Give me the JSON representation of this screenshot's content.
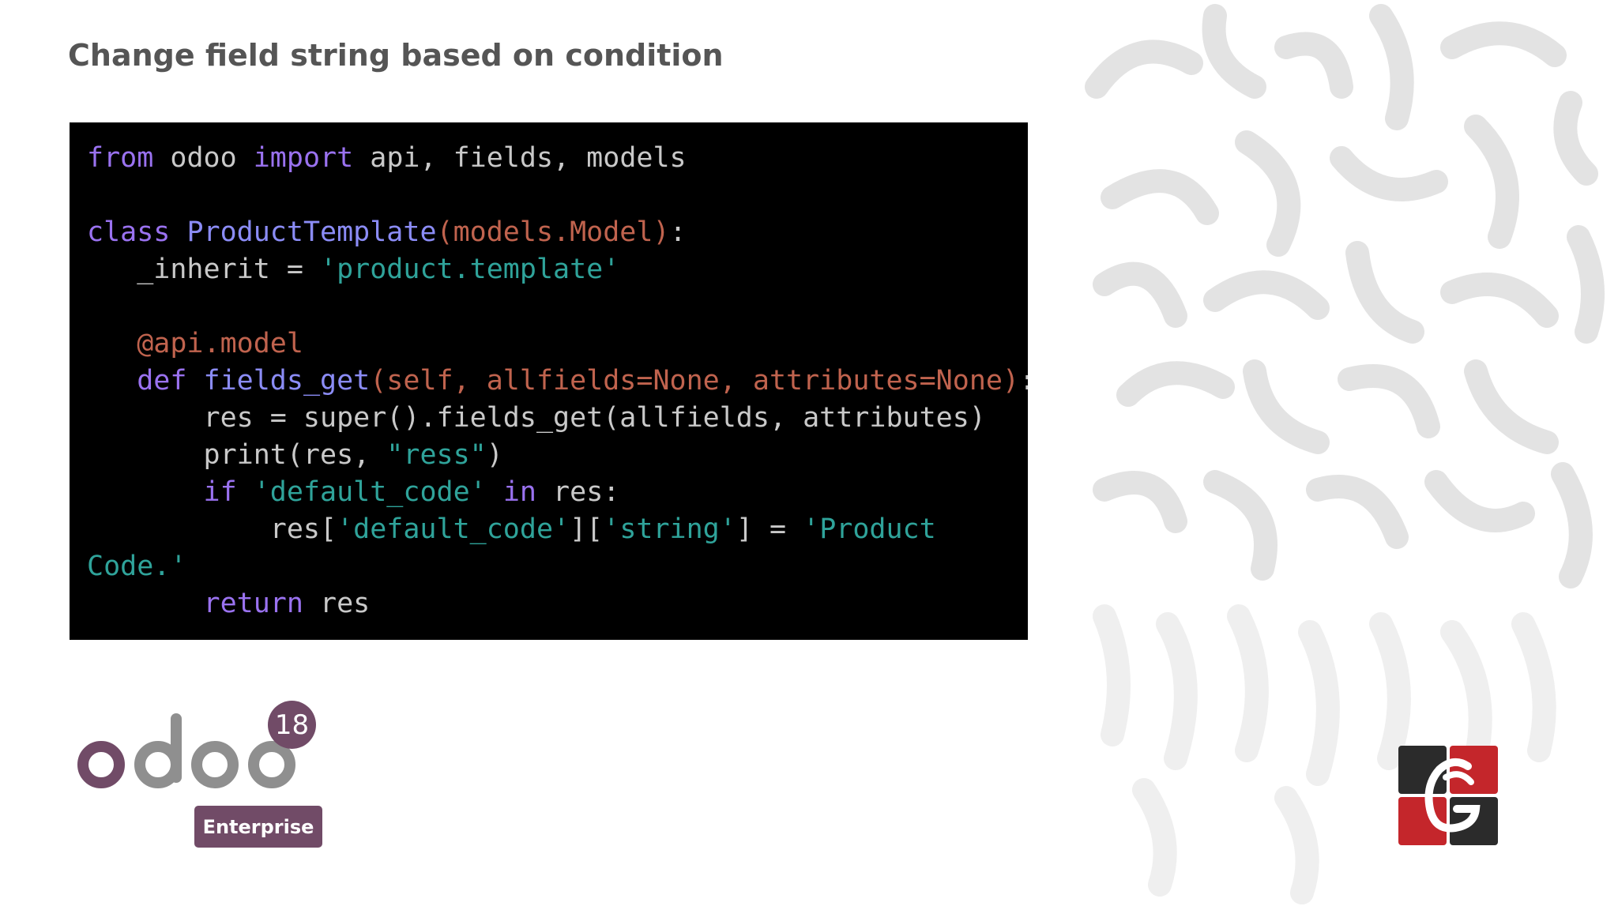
{
  "slide": {
    "title": "Change field string based on condition"
  },
  "code": {
    "lines": [
      [
        {
          "t": "kw",
          "v": "from"
        },
        {
          "t": "plain",
          "v": " odoo "
        },
        {
          "t": "kw",
          "v": "import"
        },
        {
          "t": "plain",
          "v": " api, fields, models"
        }
      ],
      [],
      [
        {
          "t": "kw",
          "v": "class"
        },
        {
          "t": "plain",
          "v": " "
        },
        {
          "t": "cls",
          "v": "ProductTemplate"
        },
        {
          "t": "param",
          "v": "(models.Model)"
        },
        {
          "t": "plain",
          "v": ":"
        }
      ],
      [
        {
          "t": "plain",
          "v": "   _inherit = "
        },
        {
          "t": "str",
          "v": "'product.template'"
        }
      ],
      [],
      [
        {
          "t": "dec",
          "v": "   @api.model"
        }
      ],
      [
        {
          "t": "kw",
          "v": "   def"
        },
        {
          "t": "plain",
          "v": " "
        },
        {
          "t": "fn",
          "v": "fields_get"
        },
        {
          "t": "param",
          "v": "(self, allfields=None, attributes=None)"
        },
        {
          "t": "plain",
          "v": ":"
        }
      ],
      [
        {
          "t": "plain",
          "v": "       res = super().fields_get(allfields, attributes)"
        }
      ],
      [
        {
          "t": "plain",
          "v": "       print(res, "
        },
        {
          "t": "str",
          "v": "\"ress\""
        },
        {
          "t": "plain",
          "v": ")"
        }
      ],
      [
        {
          "t": "kw",
          "v": "       if"
        },
        {
          "t": "plain",
          "v": " "
        },
        {
          "t": "str",
          "v": "'default_code'"
        },
        {
          "t": "plain",
          "v": " "
        },
        {
          "t": "kw",
          "v": "in"
        },
        {
          "t": "plain",
          "v": " res:"
        }
      ],
      [
        {
          "t": "plain",
          "v": "           res["
        },
        {
          "t": "str",
          "v": "'default_code'"
        },
        {
          "t": "plain",
          "v": "]["
        },
        {
          "t": "str",
          "v": "'string'"
        },
        {
          "t": "plain",
          "v": "] = "
        },
        {
          "t": "str",
          "v": "'Product"
        }
      ],
      [
        {
          "t": "str",
          "v": "Code.'"
        }
      ],
      [
        {
          "t": "kw",
          "v": "       return"
        },
        {
          "t": "plain",
          "v": " res"
        }
      ]
    ]
  },
  "branding": {
    "product_logo_icon": "odoo-wordmark-icon",
    "version": "18",
    "edition": "Enterprise",
    "company_logo_icon": "company-monogram-icon"
  },
  "colors": {
    "brand_purple": "#714b67",
    "odoo_grey": "#8f8f8f",
    "code_bg": "#000000",
    "keyword": "#9a72f0",
    "string": "#2fa39a",
    "param": "#c0634e",
    "logo_red": "#c4262b",
    "logo_dark": "#2b2b2b"
  }
}
